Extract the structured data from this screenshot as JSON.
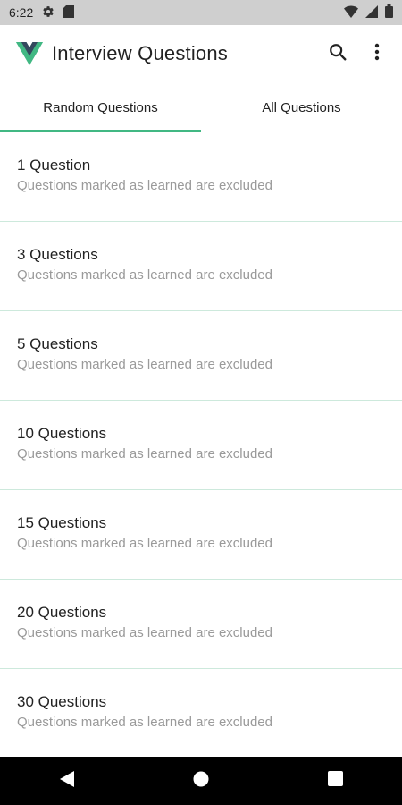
{
  "status_bar": {
    "time": "6:22",
    "icons": [
      "gear-icon",
      "sd-card-icon",
      "wifi-icon",
      "signal-icon",
      "battery-icon"
    ]
  },
  "app_bar": {
    "title": "Interview Questions",
    "logo_icon": "vue-logo-icon",
    "actions": [
      "search-icon",
      "more-vert-icon"
    ]
  },
  "tabs": [
    {
      "label": "Random Questions",
      "active": true
    },
    {
      "label": "All Questions",
      "active": false
    }
  ],
  "list": [
    {
      "title": "1 Question",
      "subtitle": "Questions marked as learned are excluded"
    },
    {
      "title": "3 Questions",
      "subtitle": "Questions marked as learned are excluded"
    },
    {
      "title": "5 Questions",
      "subtitle": "Questions marked as learned are excluded"
    },
    {
      "title": "10 Questions",
      "subtitle": "Questions marked as learned are excluded"
    },
    {
      "title": "15 Questions",
      "subtitle": "Questions marked as learned are excluded"
    },
    {
      "title": "20 Questions",
      "subtitle": "Questions marked as learned are excluded"
    },
    {
      "title": "30 Questions",
      "subtitle": "Questions marked as learned are excluded"
    }
  ],
  "nav_bar": {
    "icons": [
      "back-icon",
      "home-icon",
      "recents-icon"
    ]
  },
  "colors": {
    "accent": "#41b883",
    "logo_dark": "#34495e",
    "status_bar": "#cfcfcf",
    "divider": "#cde9dc",
    "subtitle": "#9a9a9a"
  }
}
